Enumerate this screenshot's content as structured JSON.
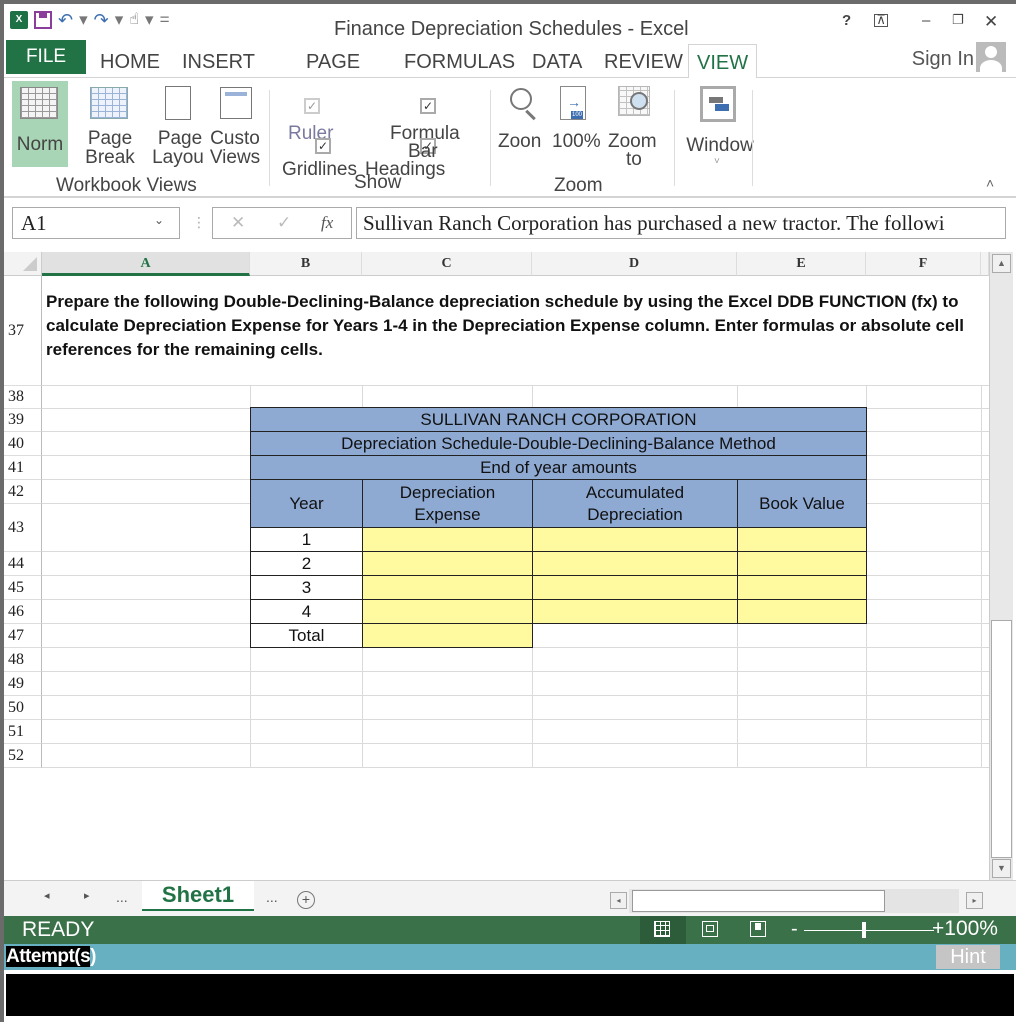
{
  "window": {
    "title": "Finance Depreciation Schedules - Excel",
    "controls": {
      "help": "?",
      "ribbon_display": "⊼",
      "minimize": "–",
      "restore": "🗗",
      "close": "✕"
    }
  },
  "qat": {
    "logo": "X",
    "more": "="
  },
  "tabs": {
    "file": "FILE",
    "home": "HOME",
    "insert": "INSERT",
    "page": "PAGE",
    "formulas": "FORMULAS",
    "data": "DATA",
    "review": "REVIEW",
    "view": "VIEW",
    "active": "VIEW"
  },
  "account": {
    "signin": "Sign In"
  },
  "ribbon": {
    "workbook_views": {
      "label": "Workbook Views",
      "normal": "Norm",
      "page_break_1": "Page",
      "page_break_2": "Break",
      "page_layout_1": "Page",
      "page_layout_2": "Layou",
      "custom_1": "Custo",
      "custom_2": "Views"
    },
    "show": {
      "label": "Show",
      "ruler": "Ruler",
      "ruler_checked": true,
      "gridlines": "Gridlines",
      "gridlines_checked": true,
      "formula_bar_1": "Formula",
      "formula_bar_2": "Bar",
      "formula_bar_checked": true,
      "headings": "Headings",
      "headings_checked": true,
      "check_glyph": "✓"
    },
    "zoom": {
      "label": "Zoom",
      "zoom": "Zoon",
      "zoom100": "100%",
      "zoom_to_1": "Zoom",
      "zoom_to_2": "to",
      "badge": "100"
    },
    "window": {
      "label": "Window",
      "dropdown": "˅"
    },
    "collapse": "˄"
  },
  "formula_bar": {
    "name_box": "A1",
    "cancel": "✕",
    "enter": "✓",
    "fx": "fx",
    "content": "Sullivan Ranch Corporation has purchased a new tractor.  The followi"
  },
  "sheet": {
    "columns": [
      "A",
      "B",
      "C",
      "D",
      "E",
      "F"
    ],
    "selected_column": "A",
    "rows": [
      "37",
      "38",
      "39",
      "40",
      "41",
      "42",
      "43",
      "44",
      "45",
      "46",
      "47",
      "48",
      "49",
      "50",
      "51",
      "52"
    ],
    "instruction": "Prepare the following Double-Declining-Balance depreciation schedule by using the Excel DDB FUNCTION (fx) to calculate Depreciation Expense for Years 1-4 in the Depreciation Expense column. Enter formulas or absolute cell references for the remaining cells.",
    "schedule": {
      "company": "SULLIVAN RANCH CORPORATION",
      "subtitle": "Depreciation Schedule-Double-Declining-Balance Method",
      "note": "End of year amounts",
      "headers": {
        "year": "Year",
        "dep_exp_1": "Depreciation",
        "dep_exp_2": "Expense",
        "acc_dep_1": "Accumulated",
        "acc_dep_2": "Depreciation",
        "book_value": "Book Value"
      },
      "years": [
        "1",
        "2",
        "3",
        "4"
      ],
      "total_label": "Total",
      "header_color": "#8ea9d2",
      "input_color": "#fffaa0"
    }
  },
  "sheet_tabs": {
    "prev": "◂",
    "next": "▸",
    "ellipsis_left": "...",
    "ellipsis_right": "...",
    "active": "Sheet1",
    "add": "+"
  },
  "scroll": {
    "up": "▲",
    "down": "▼",
    "left": "◂",
    "right": "▸"
  },
  "status": {
    "ready": "READY",
    "zoom_minus": "-",
    "zoom_level": "+100%",
    "zoom_percent": 100
  },
  "attempts": {
    "label_a": "Attempt(s",
    "label_b": ")",
    "hint": "Hint"
  }
}
